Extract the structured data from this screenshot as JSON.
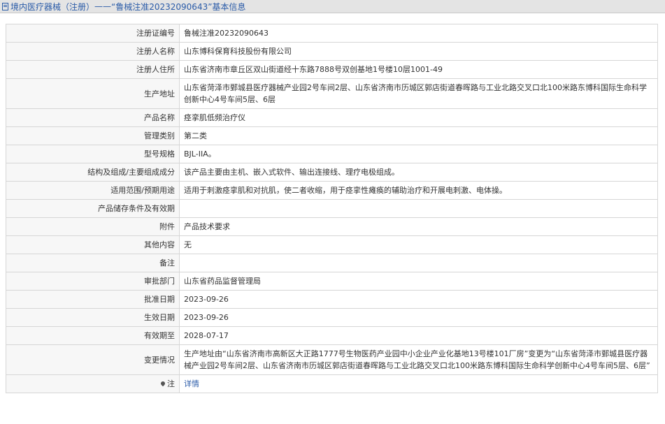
{
  "header": {
    "section": "境内医疗器械（注册）",
    "separator": " —— ",
    "record_title": "“鲁械注准20232090643”基本信息"
  },
  "rows": [
    {
      "label": "注册证编号",
      "value": "鲁械注准20232090643"
    },
    {
      "label": "注册人名称",
      "value": "山东博科保育科技股份有限公司"
    },
    {
      "label": "注册人住所",
      "value": "山东省济南市章丘区双山街道经十东路7888号双创基地1号楼10层1001-49"
    },
    {
      "label": "生产地址",
      "value": "山东省菏泽市鄄城县医疗器械产业园2号车间2层、山东省济南市历城区郭店街道春晖路与工业北路交叉口北100米路东博科国际生命科学创新中心4号车间5层、6层"
    },
    {
      "label": "产品名称",
      "value": "痉挛肌低频治疗仪"
    },
    {
      "label": "管理类别",
      "value": "第二类"
    },
    {
      "label": "型号规格",
      "value": "BJL-IIA。"
    },
    {
      "label": "结构及组成/主要组成成分",
      "value": "该产品主要由主机、嵌入式软件、输出连接线、理疗电极组成。"
    },
    {
      "label": "适用范围/预期用途",
      "value": "适用于刺激痉挛肌和对抗肌，使二者收缩，用于痉挛性瘫痪的辅助治疗和开展电刺激、电体操。"
    },
    {
      "label": "产品储存条件及有效期",
      "value": ""
    },
    {
      "label": "附件",
      "value": "产品技术要求"
    },
    {
      "label": "其他内容",
      "value": "无"
    },
    {
      "label": "备注",
      "value": ""
    },
    {
      "label": "审批部门",
      "value": "山东省药品监督管理局"
    },
    {
      "label": "批准日期",
      "value": "2023-09-26"
    },
    {
      "label": "生效日期",
      "value": "2023-09-26"
    },
    {
      "label": "有效期至",
      "value": "2028-07-17"
    },
    {
      "label": "变更情况",
      "value": "生产地址由“山东省济南市高新区大正路1777号生物医药产业园中小企业产业化基地13号楼101厂房”变更为“山东省菏泽市鄄城县医疗器械产业园2号车间2层、山东省济南市历城区郭店街道春晖路与工业北路交叉口北100米路东博科国际生命科学创新中心4号车间5层、6层”"
    }
  ],
  "note_row": {
    "label": "注",
    "icon": "pin-icon",
    "link_text": "详情"
  },
  "colors": {
    "title_text": "#2a5ba8",
    "label_bg": "#f7f7f7",
    "border": "#d6d6d6"
  }
}
